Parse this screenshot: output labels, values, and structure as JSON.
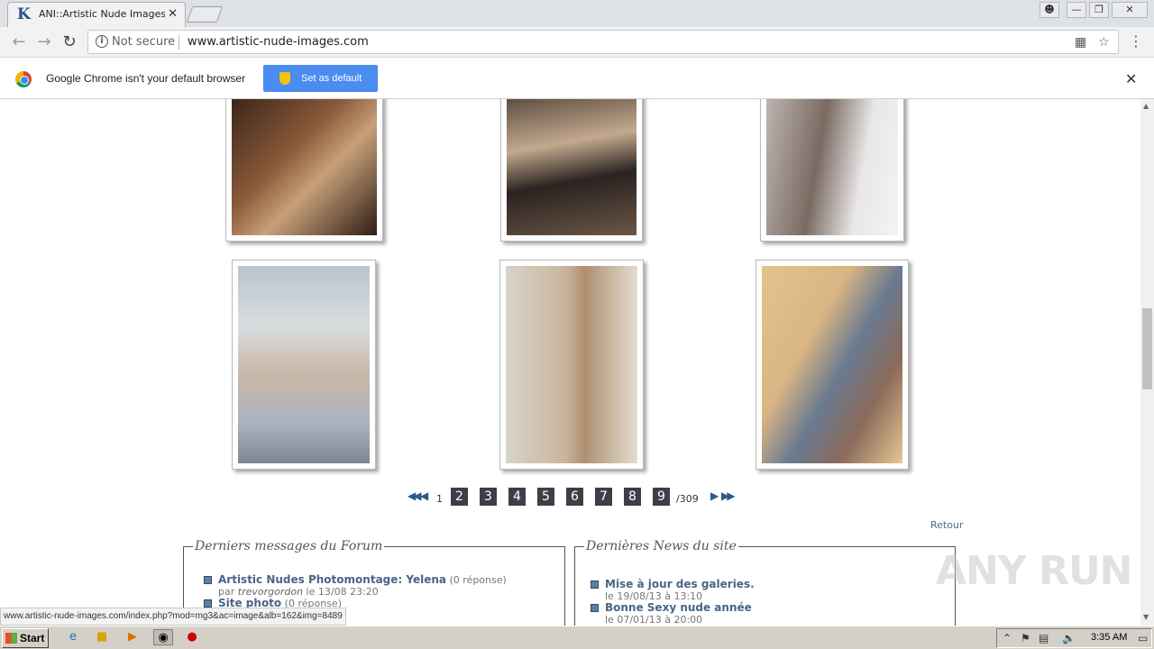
{
  "browser": {
    "tab_title": "ANI::Artistic Nude Images::",
    "tab_favicon": "K",
    "security_label": "Not secure",
    "url": "www.artistic-nude-images.com"
  },
  "infobar": {
    "message": "Google Chrome isn't your default browser",
    "button_label": "Set as default"
  },
  "pagination": {
    "current": "1",
    "pages": [
      "2",
      "3",
      "4",
      "5",
      "6",
      "7",
      "8",
      "9"
    ],
    "total": "/309"
  },
  "retour_label": "Retour",
  "forum": {
    "title": "Derniers messages du Forum",
    "items": [
      {
        "title": "Artistic Nudes Photomontage: Yelena",
        "replies": "(0 réponse)",
        "by": "par",
        "author": "trevorgordon",
        "date": "le 13/08 23:20"
      },
      {
        "title": "Site photo",
        "replies": "(0 réponse)",
        "by": "",
        "author": "",
        "date": ""
      }
    ]
  },
  "news": {
    "title": "Dernières News du site",
    "items": [
      {
        "title": "Mise à jour des galeries.",
        "date": "le 19/08/13 à 13:10"
      },
      {
        "title": "Bonne Sexy nude année",
        "date": "le 07/01/13 à 20:00"
      }
    ]
  },
  "status_url": "www.artistic-nude-images.com/index.php?mod=mg3&ac=image&alb=162&img=8489",
  "watermark": "ANY RUN",
  "taskbar": {
    "start_label": "Start",
    "clock": "3:35 AM"
  }
}
